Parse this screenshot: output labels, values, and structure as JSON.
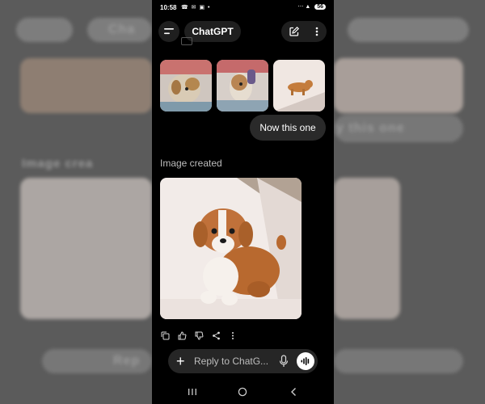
{
  "status": {
    "time": "10:58",
    "left_icons": "☎ ✉ ▣ •",
    "right_icons": "⋯ ▲",
    "battery": "56"
  },
  "header": {
    "title": "ChatGPT"
  },
  "chat": {
    "user_message": "Now this one",
    "image_status": "Image created"
  },
  "composer": {
    "placeholder": "Reply to ChatG...",
    "plus_symbol": "+"
  },
  "background": {
    "title_fragment": "Cha",
    "message_fragment": "y this one",
    "status_fragment": "Image crea",
    "reply_fragment": "Rep"
  },
  "icons": {
    "menu": "menu-icon",
    "new_chat": "new-chat-icon",
    "more": "more-icon",
    "copy": "copy-icon",
    "thumb_up": "thumbs-up-icon",
    "thumb_down": "thumbs-down-icon",
    "share": "share-icon",
    "mic": "microphone-icon",
    "voice": "voice-mode-icon"
  },
  "colors": {
    "app_bg": "#000000",
    "surface": "#1f1f1f",
    "bubble": "#2a2a2a",
    "text": "#ffffff",
    "muted": "#bdbdbd"
  }
}
